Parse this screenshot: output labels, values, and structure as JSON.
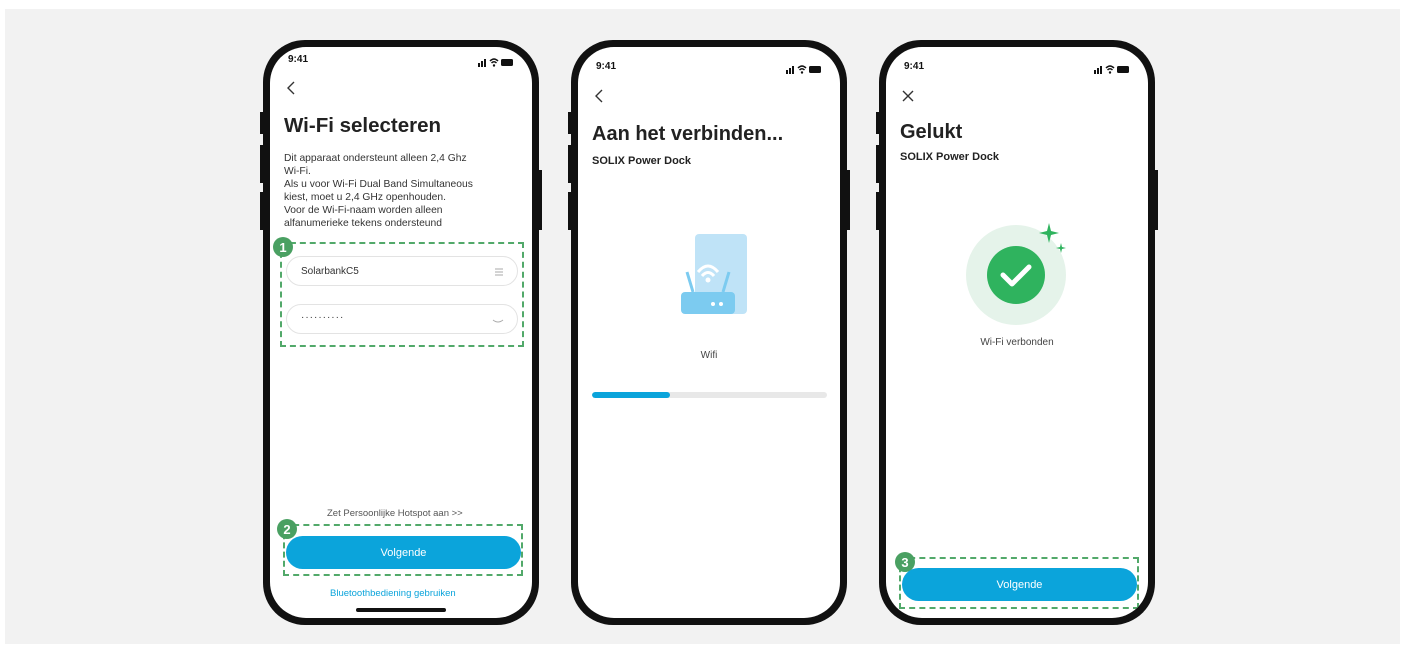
{
  "phone1": {
    "time": "9:41",
    "title": "Wi-Fi selecteren",
    "description": [
      "Dit apparaat ondersteunt alleen 2,4 Ghz",
      "Wi-Fi.",
      "Als u voor Wi-Fi Dual Band Simultaneous",
      "kiest, moet u 2,4 GHz openhouden.",
      "Voor de Wi-Fi-naam worden alleen",
      "alfanumerieke tekens ondersteund"
    ],
    "ssid_value": "SolarbankC5",
    "password_value": "··········",
    "hotspot_link": "Zet Persoonlijke Hotspot aan  >>",
    "next_button": "Volgende",
    "bluetooth_link": "Bluetoothbediening gebruiken",
    "badge1": "1",
    "badge2": "2"
  },
  "phone2": {
    "time": "9:41",
    "title": "Aan het verbinden...",
    "subtitle": "SOLIX Power Dock",
    "device_label": "Wifi",
    "progress": 0.33
  },
  "phone3": {
    "time": "9:41",
    "title": "Gelukt",
    "subtitle": "SOLIX Power Dock",
    "status_text": "Wi-Fi verbonden",
    "next_button": "Volgende",
    "badge3": "3"
  },
  "colors": {
    "accent": "#0ba4db",
    "badge_green": "#4aa062",
    "success_green": "#2fb35e",
    "dashed_border": "#52a96a"
  }
}
